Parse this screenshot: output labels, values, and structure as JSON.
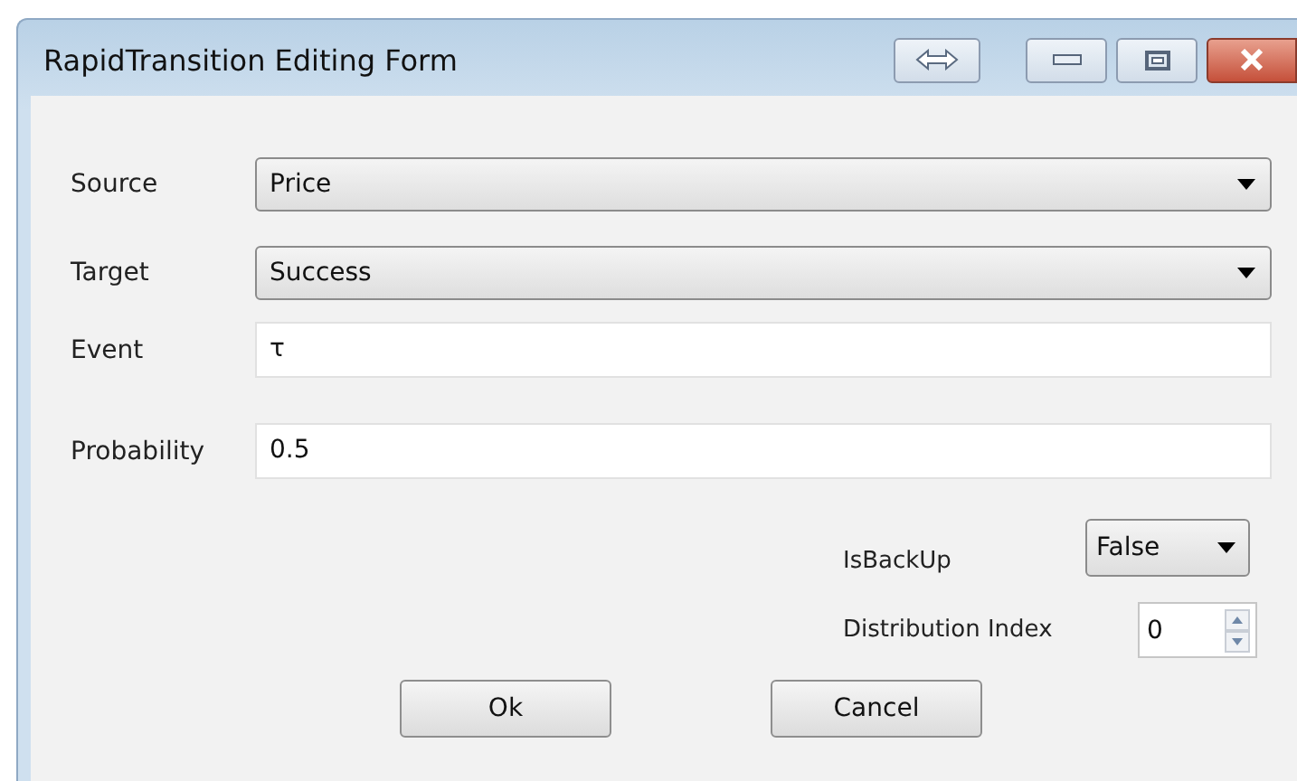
{
  "window": {
    "title": "RapidTransition Editing Form"
  },
  "fields": [
    {
      "kind": "combo",
      "label": "Source",
      "value": "Price"
    },
    {
      "kind": "combo",
      "label": "Target",
      "value": "Success"
    },
    {
      "kind": "text",
      "label": "Event",
      "value": "τ"
    },
    {
      "kind": "text",
      "label": "Probability",
      "value": "0.5"
    }
  ],
  "options": [
    {
      "kind": "combo",
      "label": "IsBackUp",
      "value": "False"
    },
    {
      "kind": "spinner",
      "label": "Distribution Index",
      "value": "0"
    }
  ],
  "buttons": [
    "Ok",
    "Cancel"
  ]
}
